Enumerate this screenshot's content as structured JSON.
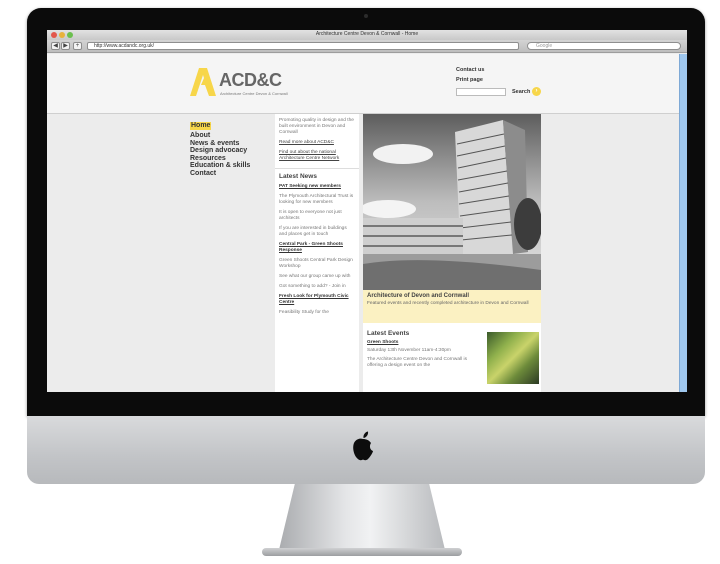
{
  "browser": {
    "window_title": "Architecture Centre Devon & Cornwall - Home",
    "url": "http://www.acdandc.org.uk/",
    "search_placeholder": "Google",
    "back": "◀",
    "forward": "▶",
    "add": "+"
  },
  "site": {
    "logo_text": "ACD&C",
    "logo_sub": "Architecture Centre Devon & Cornwall",
    "header_links": [
      "Contact us",
      "Print page"
    ],
    "search_label": "Search",
    "search_go": "›"
  },
  "nav": {
    "items": [
      "Home",
      "About",
      "News & events",
      "Design advocacy",
      "Resources",
      "Education & skills",
      "Contact"
    ],
    "active": "Home"
  },
  "intro": {
    "text": "Promoting quality in design and the built environment in Devon and Cornwall",
    "read_more": "Read more about ACD&C",
    "network_text": "Find out about the national Architecture Centre Network"
  },
  "news": {
    "heading": "Latest News",
    "items": [
      {
        "title": "PAT Seeking new members",
        "paragraphs": [
          "The Plymouth Architectural Trust is looking for new members",
          "It is open to everyone not just architects",
          "If you are interested in buildings and places get in touch"
        ]
      },
      {
        "title": "Central Park - Green Shoots Response",
        "paragraphs": [
          "Green Shoots Central Park Design Workshop",
          "See what our group came up with",
          "Got something to add? - Join in"
        ]
      },
      {
        "title": "Fresh Look for Plymouth Civic Centre",
        "paragraphs": [
          "Feasibility Study for the"
        ]
      }
    ]
  },
  "feature": {
    "heading": "Architecture of Devon and Cornwall",
    "text": "Featured events and recently completed architecture in Devon and Cornwall"
  },
  "events": {
    "heading": "Latest Events",
    "items": [
      {
        "title": "Green Shoots",
        "date": "Saturday 13th November 11am-4:30pm",
        "text": "The Architecture Centre Devon and Cornwall is offering a design event on the"
      }
    ]
  },
  "colors": {
    "accent": "#f7d64a",
    "feature_bg": "#fbf1c2",
    "scrollbar": "#9fc7ee"
  }
}
